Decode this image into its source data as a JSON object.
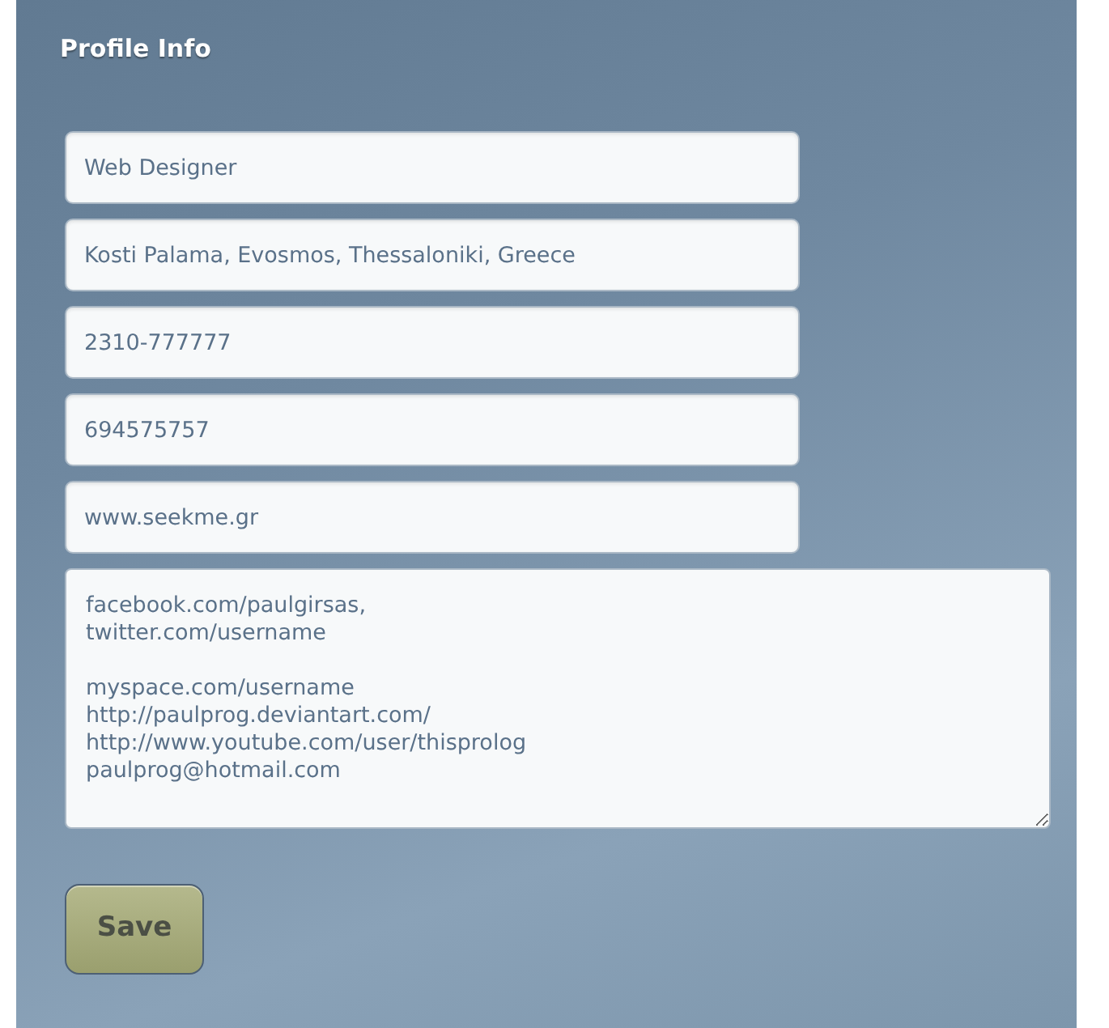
{
  "title": "Profile Info",
  "fields": [
    {
      "value": "Web Designer"
    },
    {
      "value": "Kosti Palama, Evosmos, Thessaloniki, Greece"
    },
    {
      "value": "2310-777777"
    },
    {
      "value": "694575757"
    },
    {
      "value": "www.seekme.gr"
    }
  ],
  "links_textarea": {
    "value": "facebook.com/paulgirsas,\ntwitter.com/username\n\nmyspace.com/username\nhttp://paulprog.deviantart.com/\nhttp://www.youtube.com/user/thisprolog\npaulprog@hotmail.com"
  },
  "save_button": "Save"
}
